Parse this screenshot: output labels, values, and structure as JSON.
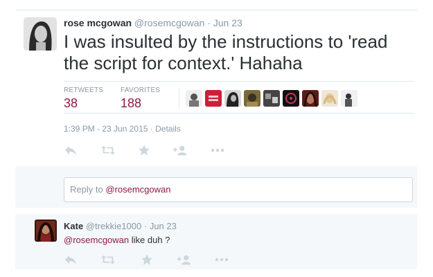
{
  "tweet": {
    "fullname": "rose mcgowan",
    "handle": "@rosemcgowan",
    "separator": "·",
    "date": "Jun 23",
    "text": "I was insulted by the instructions to 'read the script for context.' Hahaha",
    "stats": {
      "retweets_label": "RETWEETS",
      "retweets_value": "38",
      "favorites_label": "FAVORITES",
      "favorites_value": "188"
    },
    "favoriter_avatar_count": 9,
    "meta": {
      "timestamp": "1:39 PM - 23 Jun 2015",
      "separator": "·",
      "details_label": "Details"
    },
    "actions": [
      "reply-icon",
      "retweet-icon",
      "favorite-icon",
      "follow-icon",
      "more-icon"
    ]
  },
  "reply_box": {
    "prefix": "Reply to",
    "mention": "@rosemcgowan"
  },
  "reply_tweet": {
    "fullname": "Kate",
    "handle": "@trekkie1000",
    "separator": "·",
    "date": "Jun 23",
    "mention": "@rosemcgowan",
    "text": "like duh ?"
  },
  "colors": {
    "accent": "#8d1a44",
    "muted": "#8899a6",
    "text": "#292f33",
    "icon": "#ccd6dd",
    "reply_bg": "#f5f8fa"
  }
}
